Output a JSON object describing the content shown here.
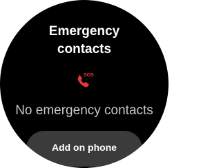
{
  "screen": {
    "title_line1": "Emergency",
    "title_line2": "contacts",
    "icon": "sos-phone-icon",
    "sos_badge": "SOS",
    "empty_message": "No emergency contacts",
    "add_button_label": "Add on phone"
  },
  "colors": {
    "background": "#000000",
    "title": "#ffffff",
    "message": "#c7c7c7",
    "icon_accent": "#e53935",
    "button_background": "#3b3b3b",
    "button_text": "#ffffff"
  }
}
